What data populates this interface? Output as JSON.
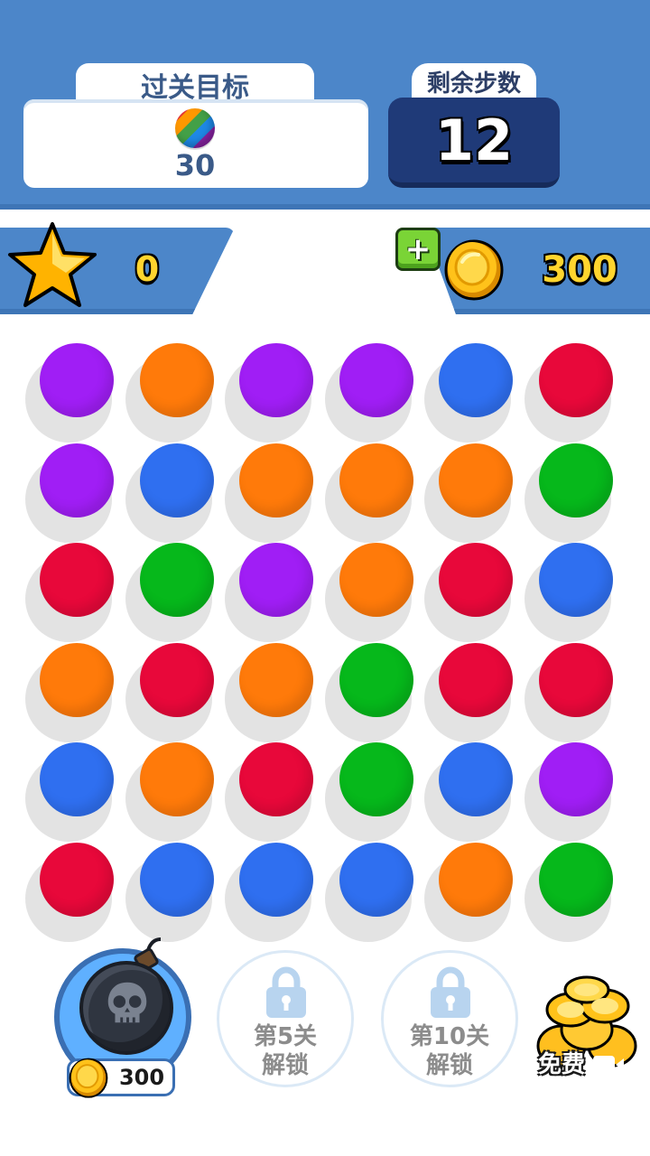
{
  "header": {
    "goal_label": "过关目标",
    "goal_count": "30",
    "steps_label": "剩余步数",
    "steps_value": "12"
  },
  "score": {
    "value": "0"
  },
  "coins": {
    "value": "300"
  },
  "colors": {
    "purple": "#a01ef5",
    "orange": "#ff7a0a",
    "blue": "#2f6ff0",
    "red": "#e8083a",
    "green": "#06b81b"
  },
  "grid": [
    [
      "purple",
      "orange",
      "purple",
      "purple",
      "blue",
      "red"
    ],
    [
      "purple",
      "blue",
      "orange",
      "orange",
      "orange",
      "green"
    ],
    [
      "red",
      "green",
      "purple",
      "orange",
      "red",
      "blue"
    ],
    [
      "orange",
      "red",
      "orange",
      "green",
      "red",
      "red"
    ],
    [
      "blue",
      "orange",
      "red",
      "green",
      "blue",
      "purple"
    ],
    [
      "red",
      "blue",
      "blue",
      "blue",
      "orange",
      "green"
    ]
  ],
  "tools": {
    "bomb_price": "300",
    "lock1_line1": "第5关",
    "lock1_line2": "解锁",
    "lock2_line1": "第10关",
    "lock2_line2": "解锁",
    "free_label": "免费"
  }
}
